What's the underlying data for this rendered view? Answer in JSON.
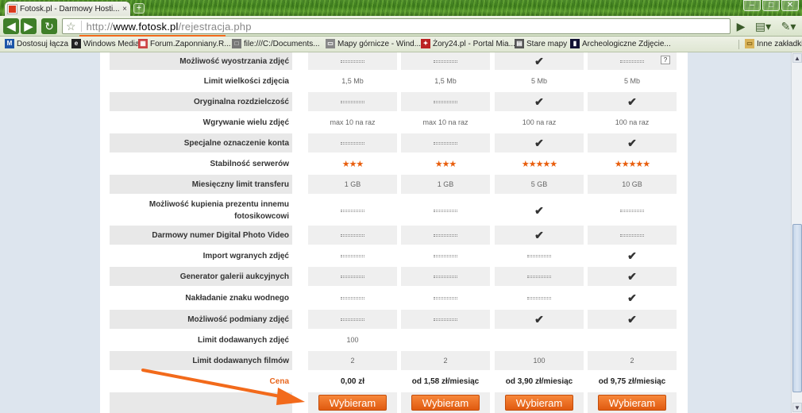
{
  "browser": {
    "tab_title": "Fotosk.pl - Darmowy Hosti...",
    "tab_close": "×",
    "new_tab": "+",
    "url_prefix": "http://",
    "url_domain": "www.fotosk.pl",
    "url_path": "/rejestracja.php",
    "window_buttons": [
      "–",
      "□",
      "✕"
    ]
  },
  "bookmarks": [
    {
      "label": "Dostosuj łącza",
      "icon": "M",
      "color": "#1d56a8"
    },
    {
      "label": "Windows Media",
      "icon": "e",
      "color": "#222"
    },
    {
      "label": "Forum.Zaponniany.R...",
      "icon": "▦",
      "color": "#c44"
    },
    {
      "label": "file:///C:/Documents...",
      "icon": "□",
      "color": "#777"
    },
    {
      "label": "Mapy górnicze - Wind...",
      "icon": "▭",
      "color": "#888"
    },
    {
      "label": "Żory24.pl - Portal Mia...",
      "icon": "✦",
      "color": "#b22"
    },
    {
      "label": "Stare mapy",
      "icon": "▤",
      "color": "#555"
    },
    {
      "label": "Archeologiczne Zdjęcie...",
      "icon": "▮",
      "color": "#113"
    }
  ],
  "other_bookmarks": "Inne zakładki",
  "icons": {
    "check": "✔",
    "stars3": "★★★",
    "stars5": "★★★★★",
    "help": "?"
  },
  "rows": [
    {
      "label": "Możliwość wyostrzania zdjęć",
      "cells": [
        "dash",
        "dash",
        "check",
        "dash"
      ],
      "help_icon": true
    },
    {
      "label": "Limit wielkości zdjęcia",
      "cells": [
        "1,5 Mb",
        "1,5 Mb",
        "5 Mb",
        "5 Mb"
      ]
    },
    {
      "label": "Oryginalna rozdzielczość",
      "cells": [
        "dash",
        "dash",
        "check",
        "check"
      ]
    },
    {
      "label": "Wgrywanie wielu zdjęć",
      "cells": [
        "max 10 na raz",
        "max 10 na raz",
        "100 na raz",
        "100 na raz"
      ]
    },
    {
      "label": "Specjalne oznaczenie konta",
      "cells": [
        "dash",
        "dash",
        "check",
        "check"
      ]
    },
    {
      "label": "Stabilność serwerów",
      "cells": [
        "stars3",
        "stars3",
        "stars5",
        "stars5"
      ]
    },
    {
      "label": "Miesięczny limit transferu",
      "cells": [
        "1 GB",
        "1 GB",
        "5 GB",
        "10 GB"
      ]
    },
    {
      "label": "Możliwość kupienia prezentu innemu fotosikowcowi",
      "cells": [
        "dash",
        "dash",
        "check",
        "dash"
      ],
      "tall": true
    },
    {
      "label": "Darmowy numer Digital Photo Video",
      "cells": [
        "dash",
        "dash",
        "check",
        "dash"
      ]
    },
    {
      "label": "Import wgranych zdjęć",
      "cells": [
        "dash",
        "dash",
        "dash",
        "check"
      ]
    },
    {
      "label": "Generator galerii aukcyjnych",
      "cells": [
        "dash",
        "dash",
        "dash",
        "check"
      ]
    },
    {
      "label": "Nakładanie znaku wodnego",
      "cells": [
        "dash",
        "dash",
        "dash",
        "check"
      ]
    },
    {
      "label": "Możliwość podmiany zdjęć",
      "cells": [
        "dash",
        "dash",
        "check",
        "check"
      ]
    },
    {
      "label": "Limit dodawanych zdjęć",
      "cells": [
        "100",
        "",
        "",
        ""
      ]
    },
    {
      "label": "Limit dodawanych filmów",
      "cells": [
        "2",
        "2",
        "100",
        "2"
      ]
    }
  ],
  "price": {
    "label": "Cena",
    "values": [
      "0,00 zł",
      "od 1,58 zł/miesiąc",
      "od 3,90 zł/miesiąc",
      "od 9,75 zł/miesiąc"
    ]
  },
  "choose_button": "Wybieram",
  "colors": {
    "accent": "#e8641a",
    "chrome_green": "#3f7f28"
  }
}
